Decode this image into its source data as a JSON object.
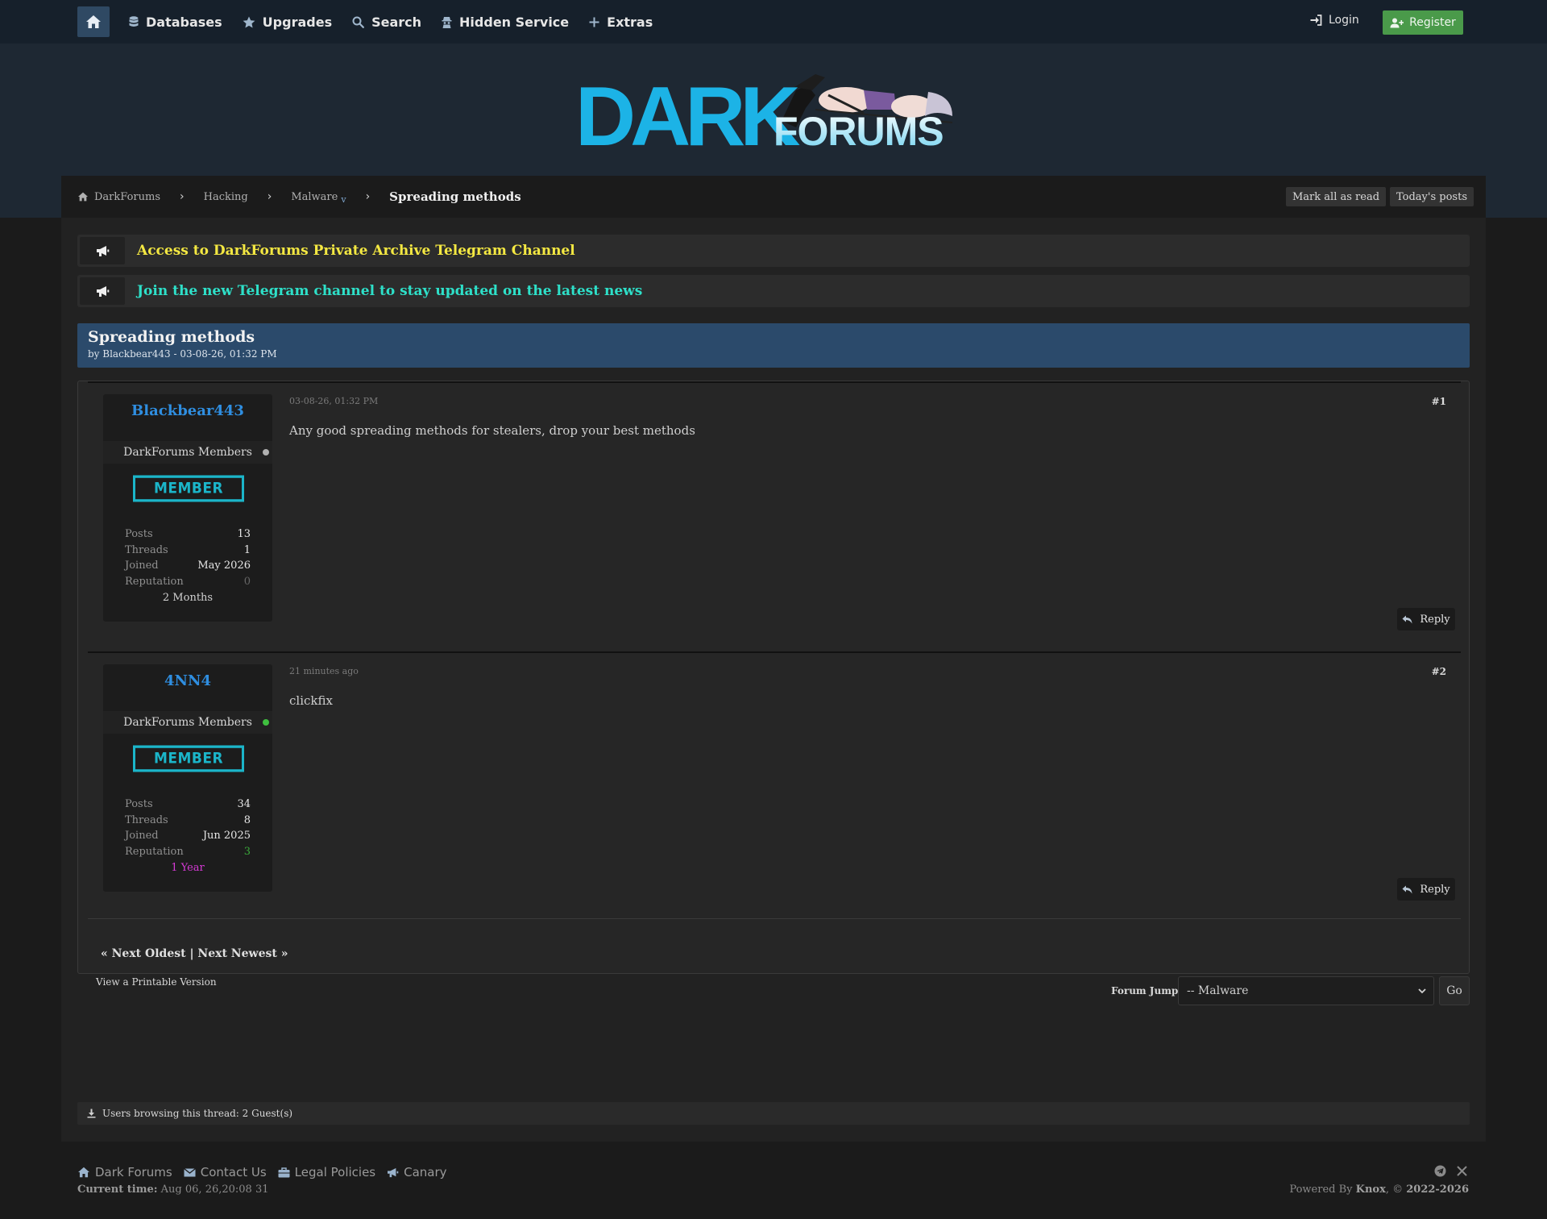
{
  "nav": {
    "items": [
      {
        "label": "Databases",
        "icon": "database-icon"
      },
      {
        "label": "Upgrades",
        "icon": "star-icon"
      },
      {
        "label": "Search",
        "icon": "search-icon"
      },
      {
        "label": "Hidden Service",
        "icon": "spy-icon"
      },
      {
        "label": "Extras",
        "icon": "plus-icon"
      }
    ],
    "login": "Login",
    "register": "Register"
  },
  "logo": {
    "text_dark": "DARK",
    "text_forums": "FORUMS"
  },
  "breadcrumb": {
    "items": [
      "DarkForums",
      "Hacking",
      "Malware"
    ],
    "dropdown_marker": "v",
    "current": "Spreading methods",
    "mark_read": "Mark all as read",
    "todays_posts": "Today's posts"
  },
  "announcements": [
    {
      "text": "Access to DarkForums Private Archive Telegram Channel",
      "color": "#f4e842"
    },
    {
      "text": "Join the new Telegram channel to stay updated on the latest news",
      "color": "#2ee0c9"
    }
  ],
  "thread": {
    "title": "Spreading methods",
    "meta": "by Blackbear443 - 03-08-26, 01:32 PM"
  },
  "posts": [
    {
      "username": "Blackbear443",
      "group": "DarkForums Members",
      "status_color": "#b0b0b0",
      "rank": "MEMBER",
      "stats": {
        "posts_label": "Posts",
        "posts": "13",
        "threads_label": "Threads",
        "threads": "1",
        "joined_label": "Joined",
        "joined": "May 2026",
        "reputation_label": "Reputation",
        "reputation": "0"
      },
      "reputation_color": "#666666",
      "age": "2 Months",
      "age_color": "#d0d0d0",
      "date": "03-08-26, 01:32 PM",
      "number": "#1",
      "body": "Any good spreading methods for stealers, drop your best methods",
      "reply": "Reply"
    },
    {
      "username": "4NN4",
      "group": "DarkForums Members",
      "status_color": "#3fbf3f",
      "rank": "MEMBER",
      "stats": {
        "posts_label": "Posts",
        "posts": "34",
        "threads_label": "Threads",
        "threads": "8",
        "joined_label": "Joined",
        "joined": "Jun 2025",
        "reputation_label": "Reputation",
        "reputation": "3"
      },
      "reputation_color": "#3aa83a",
      "age": "1 Year",
      "age_color": "#d63ad6",
      "date": "21 minutes ago",
      "number": "#2",
      "body": "clickfix",
      "reply": "Reply"
    }
  ],
  "pager": {
    "text": "« Next Oldest | Next Newest »"
  },
  "printable": "View a Printable Version",
  "forum_jump": {
    "label": "Forum Jump:",
    "selected": "-- Malware",
    "go": "Go"
  },
  "browsing": "Users browsing this thread: 2 Guest(s)",
  "footer": {
    "links": [
      {
        "label": "Dark Forums",
        "icon": "home-icon"
      },
      {
        "label": "Contact Us",
        "icon": "envelope-icon"
      },
      {
        "label": "Legal Policies",
        "icon": "briefcase-icon"
      },
      {
        "label": "Canary",
        "icon": "megaphone-icon"
      }
    ],
    "current_time_label": "Current time:",
    "current_time": "Aug 06, 26,20:08 31",
    "powered_prefix": "Powered By",
    "powered_name": "Knox",
    "powered_sep": ", ©",
    "powered_years": "2022-2026"
  }
}
